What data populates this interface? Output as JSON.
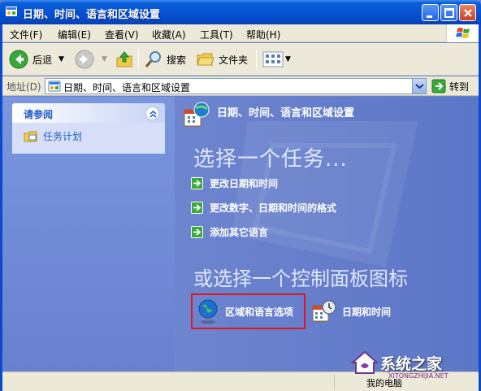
{
  "window": {
    "title": "日期、时间、语言和区域设置"
  },
  "menu": [
    {
      "label": "文件(F)"
    },
    {
      "label": "编辑(E)"
    },
    {
      "label": "查看(V)"
    },
    {
      "label": "收藏(A)"
    },
    {
      "label": "工具(T)"
    },
    {
      "label": "帮助(H)"
    }
  ],
  "toolbar": {
    "back_label": "后退",
    "search_label": "搜索",
    "folders_label": "文件夹"
  },
  "address": {
    "label": "地址(D)",
    "value": "日期、时间、语言和区域设置",
    "go_label": "转到"
  },
  "left_pane": {
    "see_also_title": "请参阅",
    "items": [
      {
        "label": "任务计划"
      }
    ]
  },
  "main": {
    "header_title": "日期、时间、语言和区域设置",
    "pick_task": "选择一个任务...",
    "tasks": [
      {
        "label": "更改日期和时间"
      },
      {
        "label": "更改数字、日期和时间的格式"
      },
      {
        "label": "添加其它语言"
      }
    ],
    "or_pick_icon": "或选择一个控制面板图标",
    "icons": [
      {
        "label": "区域和语言选项",
        "icon": "globe-icon"
      },
      {
        "label": "日期和时间",
        "icon": "calendar-clock-icon"
      }
    ]
  },
  "status": {
    "text": "我的电脑"
  },
  "watermark": {
    "brand": "系统之家",
    "url": "XITONGZHIJIA.NET"
  },
  "colors": {
    "title_bar": "#0653d3",
    "content_bg": "#6e85cf",
    "highlight": "#e0161e"
  }
}
